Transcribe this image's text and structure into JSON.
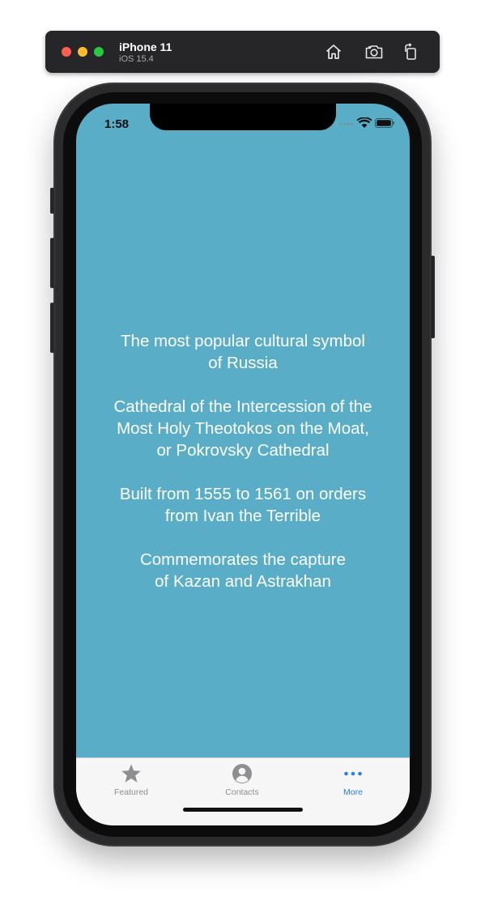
{
  "simulator": {
    "device_name": "iPhone 11",
    "os_version": "iOS 15.4",
    "buttons": {
      "home": "home-icon",
      "screenshot": "camera-icon",
      "rotate": "rotate-icon"
    }
  },
  "status_bar": {
    "time": "1:58",
    "icons": [
      "cellular-dots-icon",
      "wifi-icon",
      "battery-icon"
    ]
  },
  "screen": {
    "background_color": "#59adc6",
    "paragraphs": [
      "The most popular cultural symbol\nof Russia",
      "Cathedral of the Intercession of the\nMost Holy Theotokos on the Moat,\nor Pokrovsky Cathedral",
      "Built from 1555 to 1561 on orders\nfrom Ivan the Terrible",
      "Commemorates the capture\nof Kazan and Astrakhan"
    ]
  },
  "tab_bar": {
    "selected": "More",
    "active_color": "#2b7ee4",
    "inactive_color": "#8e8e93",
    "tabs": [
      {
        "label": "Featured",
        "icon": "star-icon"
      },
      {
        "label": "Contacts",
        "icon": "person-circle-icon"
      },
      {
        "label": "More",
        "icon": "ellipsis-icon"
      }
    ]
  }
}
